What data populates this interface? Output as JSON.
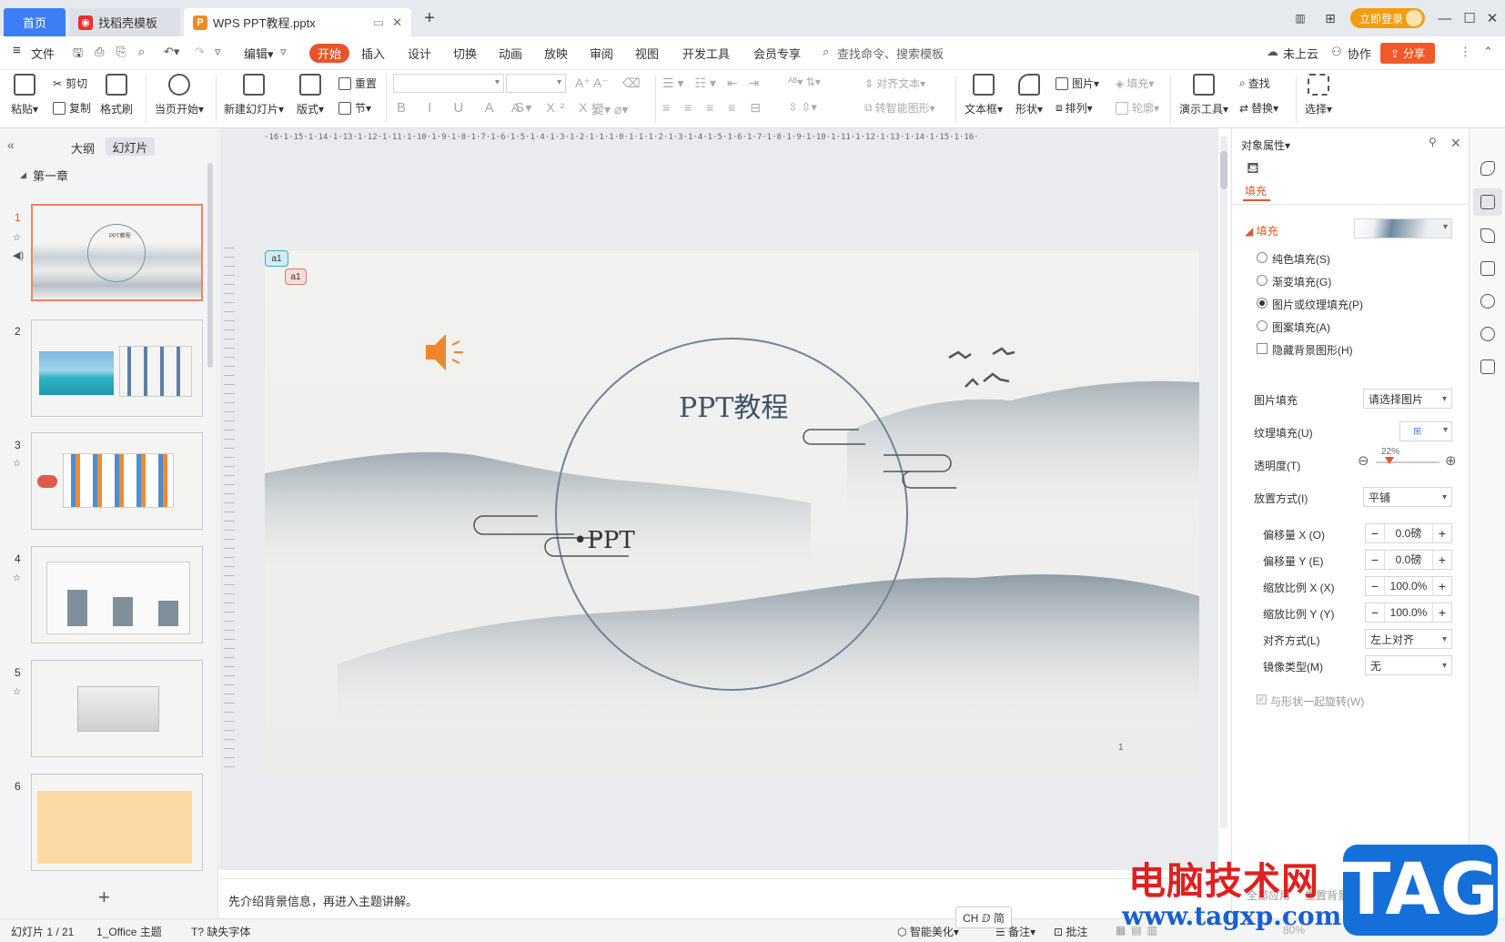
{
  "titlebar": {
    "tab_home": "首页",
    "tab_template": "找稻壳模板",
    "tab_doc": "WPS PPT教程.pptx",
    "new_tab": "+",
    "login": "立即登录",
    "win_min": "—",
    "win_max": "☐",
    "win_close": "✕"
  },
  "menu": {
    "file": "文件",
    "edit": "编辑",
    "start": "开始",
    "insert": "插入",
    "design": "设计",
    "switch": "切换",
    "animation": "动画",
    "show": "放映",
    "review": "审阅",
    "view": "视图",
    "dev": "开发工具",
    "vip": "会员专享",
    "search": "查找命令、搜索模板",
    "cloud": "未上云",
    "collab": "协作",
    "share": "分享"
  },
  "ribbon": {
    "paste": "粘贴",
    "cut": "剪切",
    "copy": "复制",
    "format_brush": "格式刷",
    "play_current": "当页开始",
    "new_slide": "新建幻灯片",
    "layout": "版式",
    "reset": "重置",
    "section": "节",
    "align_text": "对齐文本",
    "smart_shape": "转智能图形",
    "textbox": "文本框",
    "shape": "形状",
    "picture": "图片",
    "fill": "填充",
    "arrange": "排列",
    "outline": "轮廓",
    "present_tools": "演示工具",
    "find": "查找",
    "replace": "替换",
    "select": "选择"
  },
  "leftpanel": {
    "tab_outline": "大纲",
    "tab_slides": "幻灯片",
    "chapter": "第一章",
    "slides": [
      "1",
      "2",
      "3",
      "4",
      "5",
      "6"
    ],
    "add": "+"
  },
  "slide": {
    "title": "PPT教程",
    "bullet": "•PPT",
    "page_number": "1",
    "comment1": "a1",
    "comment2": "a1"
  },
  "ruler_h": "·16·1·15·1·14·1·13·1·12·1·11·1·10·1·9·1·8·1·7·1·6·1·5·1·4·1·3·1·2·1·1·1·0·1·1·1·2·1·3·1·4·1·5·1·6·1·7·1·8·1·9·1·10·1·11·1·12·1·13·1·14·1·15·1·16·",
  "notes": "先介绍背景信息，再进入主题讲解。",
  "rightpanel": {
    "header": "对象属性",
    "tab_fill": "填充",
    "section_fill": "填充",
    "opt_solid": "纯色填充(S)",
    "opt_gradient": "渐变填充(G)",
    "opt_picture": "图片或纹理填充(P)",
    "opt_pattern": "图案填充(A)",
    "opt_hide_bg": "隐藏背景图形(H)",
    "pic_fill_label": "图片填充",
    "pic_fill_value": "请选择图片",
    "texture_label": "纹理填充(U)",
    "transparency_label": "透明度(T)",
    "transparency_value": "22%",
    "transparency_level": 0.22,
    "placement_label": "放置方式(I)",
    "placement_value": "平铺",
    "offset_x_label": "偏移量 X (O)",
    "offset_x": "0.0磅",
    "offset_y_label": "偏移量 Y (E)",
    "offset_y": "0.0磅",
    "scale_x_label": "缩放比例 X (X)",
    "scale_x": "100.0%",
    "scale_y_label": "缩放比例 Y (Y)",
    "scale_y": "100.0%",
    "align_label": "对齐方式(L)",
    "align_value": "左上对齐",
    "mirror_label": "镜像类型(M)",
    "mirror_value": "无",
    "rotate_with_shape": "与形状一起旋转(W)",
    "apply_all": "全部应用",
    "reset_bg": "重置背景"
  },
  "statusbar": {
    "slide_count": "幻灯片 1 / 21",
    "theme": "1_Office 主题",
    "missing_font": "缺失字体",
    "smart_beautify": "智能美化",
    "notes": "备注",
    "comments": "批注",
    "zoom": "80%",
    "ime": "CH ⅅ 简"
  },
  "watermark": {
    "text": "电脑技术网",
    "url": "www.tagxp.com",
    "tag": "TAG"
  },
  "colors": {
    "accent": "#e8542a",
    "brand_blue": "#3d7ef5",
    "login": "#f39c12"
  }
}
